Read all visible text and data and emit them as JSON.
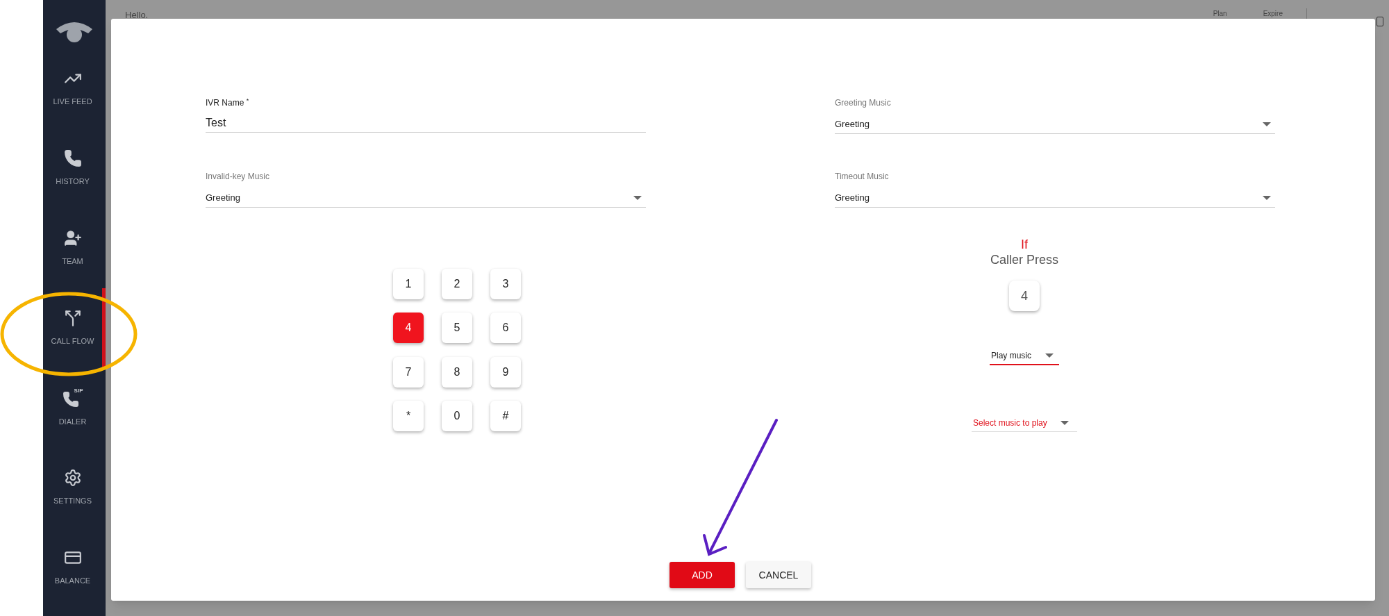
{
  "header": {
    "greeting": "Hello.",
    "plan_label": "Plan",
    "expire_label": "Expire"
  },
  "sidebar": {
    "items": [
      {
        "label": "LIVE FEED",
        "kind": "trend",
        "selected": false
      },
      {
        "label": "HISTORY",
        "kind": "phone",
        "selected": false
      },
      {
        "label": "TEAM",
        "kind": "team",
        "selected": false
      },
      {
        "label": "CALL FLOW",
        "kind": "flow",
        "selected": true
      },
      {
        "label": "DIALER",
        "kind": "sip",
        "badge": "SIP",
        "selected": false
      },
      {
        "label": "SETTINGS",
        "kind": "gear",
        "selected": false
      },
      {
        "label": "BALANCE",
        "kind": "card",
        "selected": false
      }
    ]
  },
  "form": {
    "fields": [
      {
        "label": "IVR Name $^{*}$",
        "value": "Test",
        "kind": "text"
      },
      {
        "label": "Greeting Music",
        "value": "Greeting",
        "kind": "select"
      },
      {
        "label": "Invalid-key Music",
        "value": "Greeting",
        "kind": "select"
      },
      {
        "label": "Timeout Music",
        "value": "Greeting",
        "kind": "select"
      }
    ]
  },
  "keypad": {
    "keys": [
      {
        "label": "1",
        "selected": false
      },
      {
        "label": "2",
        "selected": false
      },
      {
        "label": "3",
        "selected": false
      },
      {
        "label": "4",
        "selected": true
      },
      {
        "label": "5",
        "selected": false
      },
      {
        "label": "6",
        "selected": false
      },
      {
        "label": "7",
        "selected": false
      },
      {
        "label": "8",
        "selected": false
      },
      {
        "label": "9",
        "selected": false
      },
      {
        "label": "*",
        "selected": false
      },
      {
        "label": "0",
        "selected": false
      },
      {
        "label": "#",
        "selected": false
      }
    ]
  },
  "action": {
    "condition": "If",
    "prompt": "Caller Press",
    "pressed_key": "4",
    "action_select": {
      "value": "Play music",
      "focused": true
    },
    "music_select": {
      "placeholder": "Select music to play"
    }
  },
  "buttons": [
    {
      "label": "ADD",
      "kind": "primary"
    },
    {
      "label": "CANCEL",
      "kind": "secondary"
    }
  ]
}
